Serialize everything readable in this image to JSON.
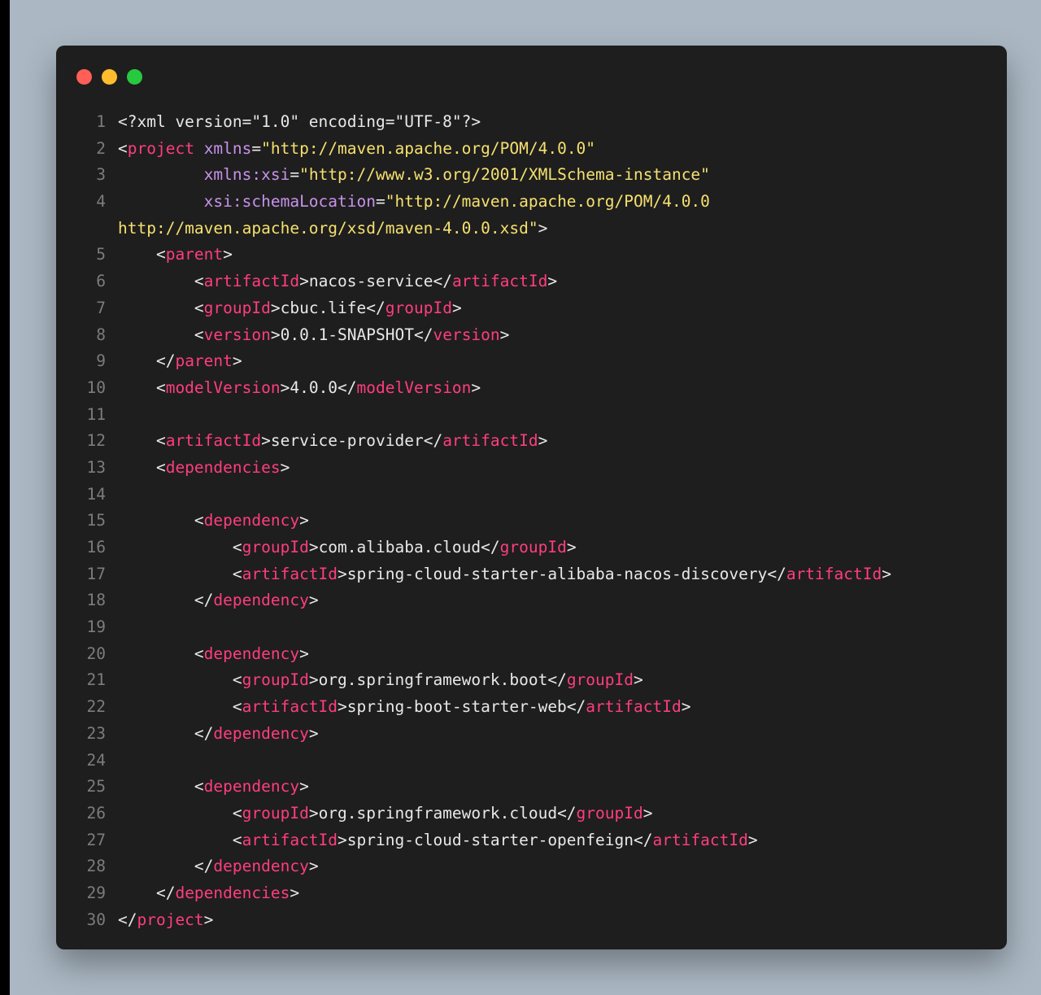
{
  "colors": {
    "background": "#abb8c3",
    "window": "#1e1e1e",
    "line_number": "#7c7c7c",
    "tag": "#ff3d7f",
    "attribute": "#c792ea",
    "string": "#f5e06e",
    "text": "#e8e8e8"
  },
  "window_controls": [
    {
      "name": "close",
      "color": "#ff5f56"
    },
    {
      "name": "minimize",
      "color": "#ffbd2e"
    },
    {
      "name": "maximize",
      "color": "#27c93f"
    }
  ],
  "code_lines": [
    {
      "num": "1",
      "tokens": [
        [
          "punc",
          "<?xml version=\"1.0\" encoding=\"UTF-8\"?>"
        ]
      ]
    },
    {
      "num": "2",
      "tokens": [
        [
          "punc",
          "<"
        ],
        [
          "tag",
          "project"
        ],
        [
          "punc",
          " "
        ],
        [
          "attr",
          "xmlns"
        ],
        [
          "punc",
          "="
        ],
        [
          "str",
          "\"http://maven.apache.org/POM/4.0.0\""
        ]
      ]
    },
    {
      "num": "3",
      "tokens": [
        [
          "punc",
          "         "
        ],
        [
          "attr",
          "xmlns:xsi"
        ],
        [
          "punc",
          "="
        ],
        [
          "str",
          "\"http://www.w3.org/2001/XMLSchema-instance\""
        ]
      ]
    },
    {
      "num": "4",
      "tokens": [
        [
          "punc",
          "         "
        ],
        [
          "attr",
          "xsi:schemaLocation"
        ],
        [
          "punc",
          "="
        ],
        [
          "str",
          "\"http://maven.apache.org/POM/4.0.0"
        ]
      ]
    },
    {
      "num": "",
      "cont": true,
      "tokens": [
        [
          "str",
          "http://maven.apache.org/xsd/maven-4.0.0.xsd\""
        ],
        [
          "punc",
          ">"
        ]
      ]
    },
    {
      "num": "5",
      "tokens": [
        [
          "punc",
          "    <"
        ],
        [
          "tag",
          "parent"
        ],
        [
          "punc",
          ">"
        ]
      ]
    },
    {
      "num": "6",
      "tokens": [
        [
          "punc",
          "        <"
        ],
        [
          "tag",
          "artifactId"
        ],
        [
          "punc",
          ">"
        ],
        [
          "text",
          "nacos-service"
        ],
        [
          "punc",
          "</"
        ],
        [
          "tag",
          "artifactId"
        ],
        [
          "punc",
          ">"
        ]
      ]
    },
    {
      "num": "7",
      "tokens": [
        [
          "punc",
          "        <"
        ],
        [
          "tag",
          "groupId"
        ],
        [
          "punc",
          ">"
        ],
        [
          "text",
          "cbuc.life"
        ],
        [
          "punc",
          "</"
        ],
        [
          "tag",
          "groupId"
        ],
        [
          "punc",
          ">"
        ]
      ]
    },
    {
      "num": "8",
      "tokens": [
        [
          "punc",
          "        <"
        ],
        [
          "tag",
          "version"
        ],
        [
          "punc",
          ">"
        ],
        [
          "text",
          "0.0.1-SNAPSHOT"
        ],
        [
          "punc",
          "</"
        ],
        [
          "tag",
          "version"
        ],
        [
          "punc",
          ">"
        ]
      ]
    },
    {
      "num": "9",
      "tokens": [
        [
          "punc",
          "    </"
        ],
        [
          "tag",
          "parent"
        ],
        [
          "punc",
          ">"
        ]
      ]
    },
    {
      "num": "10",
      "tokens": [
        [
          "punc",
          "    <"
        ],
        [
          "tag",
          "modelVersion"
        ],
        [
          "punc",
          ">"
        ],
        [
          "text",
          "4.0.0"
        ],
        [
          "punc",
          "</"
        ],
        [
          "tag",
          "modelVersion"
        ],
        [
          "punc",
          ">"
        ]
      ]
    },
    {
      "num": "11",
      "tokens": []
    },
    {
      "num": "12",
      "tokens": [
        [
          "punc",
          "    <"
        ],
        [
          "tag",
          "artifactId"
        ],
        [
          "punc",
          ">"
        ],
        [
          "text",
          "service-provider"
        ],
        [
          "punc",
          "</"
        ],
        [
          "tag",
          "artifactId"
        ],
        [
          "punc",
          ">"
        ]
      ]
    },
    {
      "num": "13",
      "tokens": [
        [
          "punc",
          "    <"
        ],
        [
          "tag",
          "dependencies"
        ],
        [
          "punc",
          ">"
        ]
      ]
    },
    {
      "num": "14",
      "tokens": []
    },
    {
      "num": "15",
      "tokens": [
        [
          "punc",
          "        <"
        ],
        [
          "tag",
          "dependency"
        ],
        [
          "punc",
          ">"
        ]
      ]
    },
    {
      "num": "16",
      "tokens": [
        [
          "punc",
          "            <"
        ],
        [
          "tag",
          "groupId"
        ],
        [
          "punc",
          ">"
        ],
        [
          "text",
          "com.alibaba.cloud"
        ],
        [
          "punc",
          "</"
        ],
        [
          "tag",
          "groupId"
        ],
        [
          "punc",
          ">"
        ]
      ]
    },
    {
      "num": "17",
      "tokens": [
        [
          "punc",
          "            <"
        ],
        [
          "tag",
          "artifactId"
        ],
        [
          "punc",
          ">"
        ],
        [
          "text",
          "spring-cloud-starter-alibaba-nacos-discovery"
        ],
        [
          "punc",
          "</"
        ],
        [
          "tag",
          "artifactId"
        ],
        [
          "punc",
          ">"
        ]
      ]
    },
    {
      "num": "18",
      "tokens": [
        [
          "punc",
          "        </"
        ],
        [
          "tag",
          "dependency"
        ],
        [
          "punc",
          ">"
        ]
      ]
    },
    {
      "num": "19",
      "tokens": []
    },
    {
      "num": "20",
      "tokens": [
        [
          "punc",
          "        <"
        ],
        [
          "tag",
          "dependency"
        ],
        [
          "punc",
          ">"
        ]
      ]
    },
    {
      "num": "21",
      "tokens": [
        [
          "punc",
          "            <"
        ],
        [
          "tag",
          "groupId"
        ],
        [
          "punc",
          ">"
        ],
        [
          "text",
          "org.springframework.boot"
        ],
        [
          "punc",
          "</"
        ],
        [
          "tag",
          "groupId"
        ],
        [
          "punc",
          ">"
        ]
      ]
    },
    {
      "num": "22",
      "tokens": [
        [
          "punc",
          "            <"
        ],
        [
          "tag",
          "artifactId"
        ],
        [
          "punc",
          ">"
        ],
        [
          "text",
          "spring-boot-starter-web"
        ],
        [
          "punc",
          "</"
        ],
        [
          "tag",
          "artifactId"
        ],
        [
          "punc",
          ">"
        ]
      ]
    },
    {
      "num": "23",
      "tokens": [
        [
          "punc",
          "        </"
        ],
        [
          "tag",
          "dependency"
        ],
        [
          "punc",
          ">"
        ]
      ]
    },
    {
      "num": "24",
      "tokens": []
    },
    {
      "num": "25",
      "tokens": [
        [
          "punc",
          "        <"
        ],
        [
          "tag",
          "dependency"
        ],
        [
          "punc",
          ">"
        ]
      ]
    },
    {
      "num": "26",
      "tokens": [
        [
          "punc",
          "            <"
        ],
        [
          "tag",
          "groupId"
        ],
        [
          "punc",
          ">"
        ],
        [
          "text",
          "org.springframework.cloud"
        ],
        [
          "punc",
          "</"
        ],
        [
          "tag",
          "groupId"
        ],
        [
          "punc",
          ">"
        ]
      ]
    },
    {
      "num": "27",
      "tokens": [
        [
          "punc",
          "            <"
        ],
        [
          "tag",
          "artifactId"
        ],
        [
          "punc",
          ">"
        ],
        [
          "text",
          "spring-cloud-starter-openfeign"
        ],
        [
          "punc",
          "</"
        ],
        [
          "tag",
          "artifactId"
        ],
        [
          "punc",
          ">"
        ]
      ]
    },
    {
      "num": "28",
      "tokens": [
        [
          "punc",
          "        </"
        ],
        [
          "tag",
          "dependency"
        ],
        [
          "punc",
          ">"
        ]
      ]
    },
    {
      "num": "29",
      "tokens": [
        [
          "punc",
          "    </"
        ],
        [
          "tag",
          "dependencies"
        ],
        [
          "punc",
          ">"
        ]
      ]
    },
    {
      "num": "30",
      "tokens": [
        [
          "punc",
          "</"
        ],
        [
          "tag",
          "project"
        ],
        [
          "punc",
          ">"
        ]
      ]
    }
  ]
}
